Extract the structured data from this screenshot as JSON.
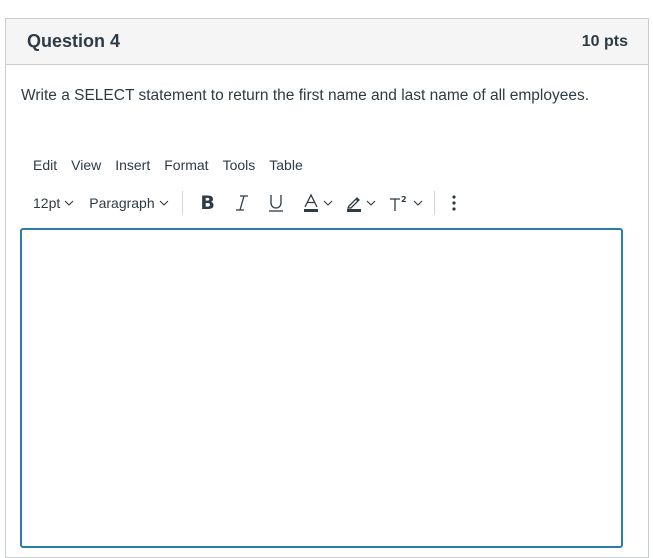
{
  "question": {
    "title": "Question 4",
    "points": "10 pts",
    "text": "Write a SELECT statement to return the first name and last name of all employees."
  },
  "editor": {
    "menubar": [
      {
        "label": "Edit"
      },
      {
        "label": "View"
      },
      {
        "label": "Insert"
      },
      {
        "label": "Format"
      },
      {
        "label": "Tools"
      },
      {
        "label": "Table"
      }
    ],
    "toolbar": {
      "font_size": "12pt",
      "block_format": "Paragraph",
      "bold": "B",
      "italic_icon": "italic-icon",
      "underline_icon": "underline-icon",
      "text_color_icon": "text-color-icon",
      "highlight_icon": "highlight-icon",
      "superscript_icon": "superscript-icon",
      "more_icon": "more-vertical-icon"
    },
    "content": "",
    "accent_color": "#2b7ea8"
  }
}
